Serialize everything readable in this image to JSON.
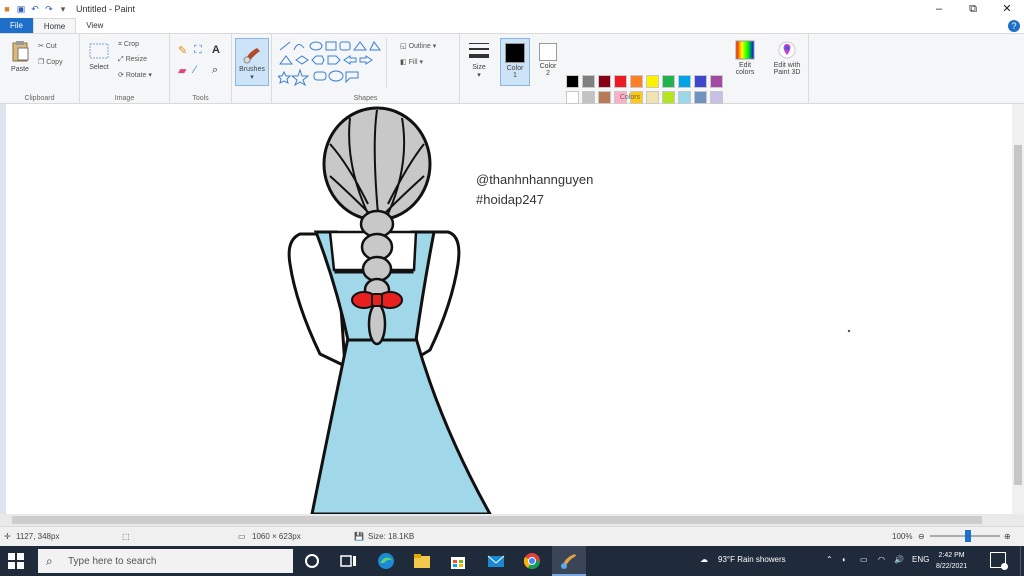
{
  "window": {
    "title": "Untitled - Paint",
    "minimize": "–",
    "maximize": "⧉",
    "close": "✕"
  },
  "tabs": [
    "File",
    "Home",
    "View"
  ],
  "ribbon": {
    "clipboard": {
      "label": "Clipboard",
      "paste": "Paste",
      "cut": "Cut",
      "copy": "Copy"
    },
    "image": {
      "label": "Image",
      "select": "Select",
      "crop": "Crop",
      "resize": "Resize",
      "rotate": "Rotate ▾"
    },
    "tools": {
      "label": "Tools"
    },
    "brushes": {
      "label": "Brushes"
    },
    "shapes": {
      "label": "Shapes",
      "outline": "Outline ▾",
      "fill": "Fill ▾"
    },
    "size": {
      "label": "Size"
    },
    "color1": {
      "label": "Color",
      "sub": "1"
    },
    "color2": {
      "label": "Color",
      "sub": "2"
    },
    "colors": {
      "label": "Colors",
      "edit_colors": "Edit colors",
      "edit_paint3d": "Edit with Paint 3D",
      "palette_row1": [
        "#000000",
        "#7f7f7f",
        "#880015",
        "#ed1c24",
        "#ff7f27",
        "#fff200",
        "#22b14c",
        "#00a2e8",
        "#3f48cc",
        "#a349a4"
      ],
      "palette_row2": [
        "#ffffff",
        "#c3c3c3",
        "#b97a57",
        "#ffaec9",
        "#ffc90e",
        "#efe4b0",
        "#b5e61d",
        "#99d9ea",
        "#7092be",
        "#c8bfe7"
      ],
      "color1_value": "#000000",
      "color2_value": "#ffffff"
    }
  },
  "canvas": {
    "caption_line1": "@thanhnhannguyen",
    "caption_line2": "#hoidap247",
    "hair_color": "#c8c8c8",
    "dress_color": "#a0d8ea",
    "bow_color": "#e8201e"
  },
  "status": {
    "cursor": "1127, 348px",
    "dimensions": "1060 × 623px",
    "size": "Size: 18.1KB",
    "zoom": "100%"
  },
  "taskbar": {
    "search_placeholder": "Type here to search",
    "weather": "93°F  Rain showers",
    "lang": "ENG",
    "time": "2:42 PM",
    "date": "8/22/2021"
  }
}
